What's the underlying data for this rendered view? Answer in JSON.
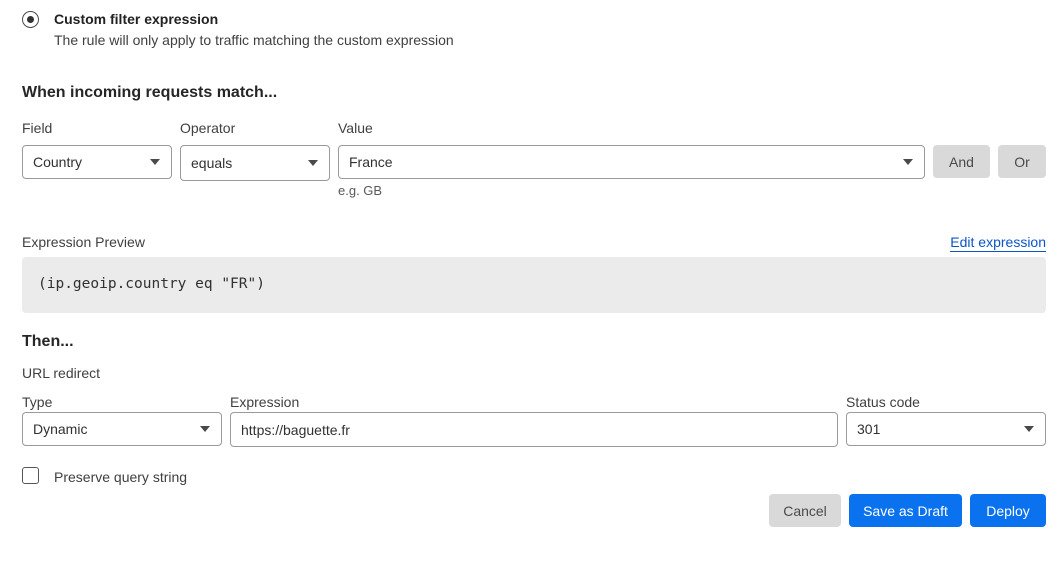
{
  "filter": {
    "radio_title": "Custom filter expression",
    "radio_desc": "The rule will only apply to traffic matching the custom expression"
  },
  "match": {
    "heading": "When incoming requests match...",
    "field_label": "Field",
    "operator_label": "Operator",
    "value_label": "Value",
    "field_value": "Country",
    "operator_value": "equals",
    "value_value": "France",
    "value_hint": "e.g. GB",
    "and_label": "And",
    "or_label": "Or"
  },
  "preview": {
    "label": "Expression Preview",
    "edit_link": "Edit expression",
    "code": "(ip.geoip.country eq \"FR\")"
  },
  "then": {
    "heading": "Then...",
    "action": "URL redirect",
    "type_label": "Type",
    "expression_label": "Expression",
    "status_label": "Status code",
    "type_value": "Dynamic",
    "expression_value": "https://baguette.fr",
    "status_value": "301",
    "preserve_label": "Preserve query string"
  },
  "actions": {
    "cancel": "Cancel",
    "draft": "Save as Draft",
    "deploy": "Deploy"
  },
  "colors": {
    "primary": "#0a72ef",
    "secondary_button": "#d9d9d9",
    "preview_bg": "#ebebeb"
  }
}
